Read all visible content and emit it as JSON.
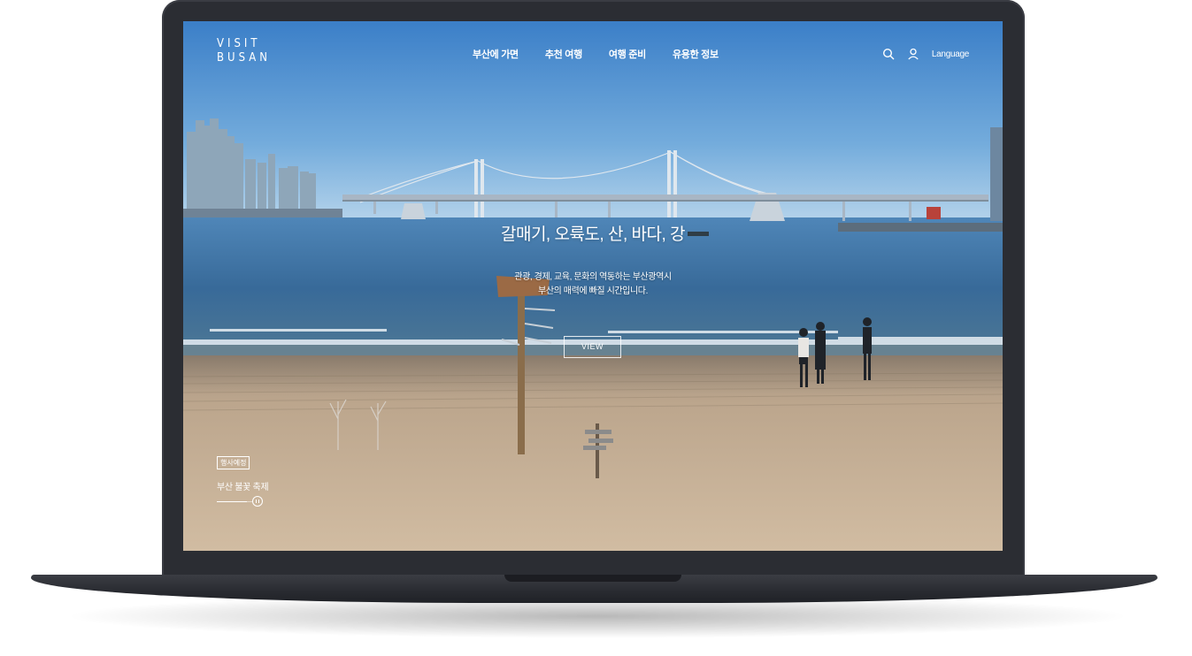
{
  "logo": {
    "line1": "VISIT",
    "line2": "BUSAN"
  },
  "nav": {
    "items": [
      {
        "label": "부산에 가면"
      },
      {
        "label": "추천 여행"
      },
      {
        "label": "여행 준비"
      },
      {
        "label": "유용한 정보"
      }
    ]
  },
  "utility": {
    "search_icon": "search-icon",
    "user_icon": "user-icon",
    "language_label": "Language"
  },
  "hero": {
    "title": "갈매기, 오륙도, 산, 바다, 강",
    "desc_line1": "관광, 경제, 교육, 문화의 역동하는 부산광역시",
    "desc_line2": "부산의 매력에 빠질 시간입니다.",
    "view_label": "VIEW"
  },
  "event": {
    "badge": "행사예정",
    "title": "부산 불꽃 축제",
    "progress": 0.85,
    "pause_icon": "pause-icon"
  },
  "colors": {
    "laptop_body": "#2b2d33",
    "sky": "#5b97d0",
    "sea": "#3d6e9a",
    "sand": "#c8b296",
    "text": "#ffffff"
  }
}
